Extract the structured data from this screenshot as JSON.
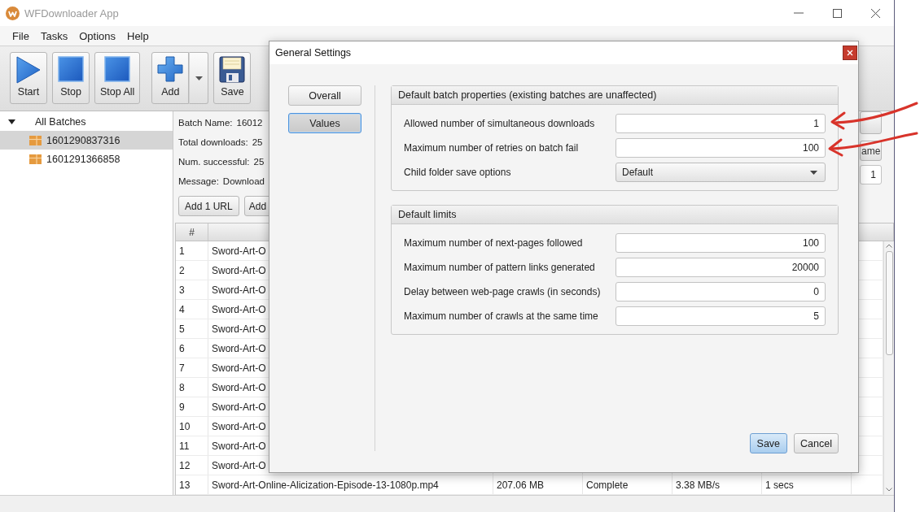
{
  "window": {
    "title": "WFDownloader App"
  },
  "menu": [
    "File",
    "Tasks",
    "Options",
    "Help"
  ],
  "toolbar": {
    "groups": [
      {
        "buttons": [
          {
            "label": "Start",
            "kind": "start",
            "dropdown": false
          },
          {
            "label": "Stop",
            "kind": "stop",
            "dropdown": false
          },
          {
            "label": "Stop All",
            "kind": "stop",
            "dropdown": false
          }
        ]
      },
      {
        "buttons": [
          {
            "label": "Add",
            "kind": "add",
            "dropdown": true
          },
          {
            "label": "Save",
            "kind": "save",
            "dropdown": false
          }
        ]
      }
    ]
  },
  "sidebar": {
    "tree": [
      {
        "label": "All Batches",
        "expanded": true,
        "selected": false,
        "children": [
          {
            "label": "1601290837316",
            "selected": true
          },
          {
            "label": "1601291366858",
            "selected": false
          }
        ]
      }
    ]
  },
  "batch_panel": {
    "fields": [
      {
        "label": "Batch Name:",
        "value": "16012"
      },
      {
        "label": "Total downloads:",
        "value": "25"
      },
      {
        "label": "Num. successful:",
        "value": "25"
      },
      {
        "label": "Message:",
        "value": "Download"
      }
    ],
    "buttons": [
      "Add 1 URL",
      "Add"
    ],
    "side_buttons": [
      "ame"
    ],
    "side_field": {
      "value": "1"
    }
  },
  "table": {
    "columns": [
      "#"
    ],
    "rows": [
      {
        "cells": [
          "1",
          "Sword-Art-O"
        ]
      },
      {
        "cells": [
          "2",
          "Sword-Art-O"
        ]
      },
      {
        "cells": [
          "3",
          "Sword-Art-O"
        ]
      },
      {
        "cells": [
          "4",
          "Sword-Art-O"
        ]
      },
      {
        "cells": [
          "5",
          "Sword-Art-O"
        ]
      },
      {
        "cells": [
          "6",
          "Sword-Art-O"
        ]
      },
      {
        "cells": [
          "7",
          "Sword-Art-O"
        ]
      },
      {
        "cells": [
          "8",
          "Sword-Art-O"
        ]
      },
      {
        "cells": [
          "9",
          "Sword-Art-O"
        ]
      },
      {
        "cells": [
          "10",
          "Sword-Art-O"
        ]
      },
      {
        "cells": [
          "11",
          "Sword-Art-O"
        ]
      },
      {
        "cells": [
          "12",
          "Sword-Art-O"
        ]
      },
      {
        "cells": [
          "13",
          "Sword-Art-Online-Alicization-Episode-13-1080p.mp4",
          "207.06 MB",
          "Complete",
          "3.38 MB/s",
          "1 secs"
        ]
      }
    ]
  },
  "dialog": {
    "title": "General Settings",
    "nav": [
      {
        "label": "Overall",
        "selected": false
      },
      {
        "label": "Values",
        "selected": true
      }
    ],
    "sections": [
      {
        "title": "Default batch properties (existing batches are unaffected)",
        "fields": [
          {
            "label": "Allowed number of simultaneous downloads",
            "kind": "text",
            "value": "1"
          },
          {
            "label": "Maximum number of retries on batch fail",
            "kind": "text",
            "value": "100"
          },
          {
            "label": "Child folder save options",
            "kind": "select",
            "value": "Default"
          }
        ]
      },
      {
        "title": "Default limits",
        "fields": [
          {
            "label": "Maximum number of next-pages followed",
            "kind": "text",
            "value": "100"
          },
          {
            "label": "Maximum number of pattern links generated",
            "kind": "text",
            "value": "20000"
          },
          {
            "label": "Delay between web-page crawls (in seconds)",
            "kind": "text",
            "value": "0"
          },
          {
            "label": "Maximum number of crawls at the same time",
            "kind": "text",
            "value": "5"
          }
        ]
      }
    ],
    "buttons": [
      {
        "label": "Save",
        "primary": true
      },
      {
        "label": "Cancel",
        "primary": false
      }
    ]
  }
}
